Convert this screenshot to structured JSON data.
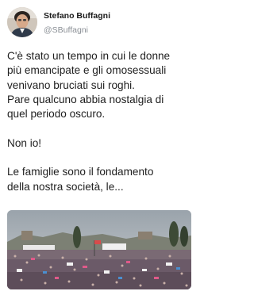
{
  "tweet": {
    "author_name": "Stefano Buffagni",
    "author_handle": "@SBuffagni",
    "lines": [
      "C'è stato un tempo in cui le donne",
      "più emancipate e gli omosessuali",
      "venivano bruciati sui roghi.",
      "Pare qualcuno abbia nostalgia di",
      "quel periodo oscuro.",
      "",
      "Non io!",
      "",
      "Le famiglie sono il fondamento",
      "della nostra società, le..."
    ]
  }
}
